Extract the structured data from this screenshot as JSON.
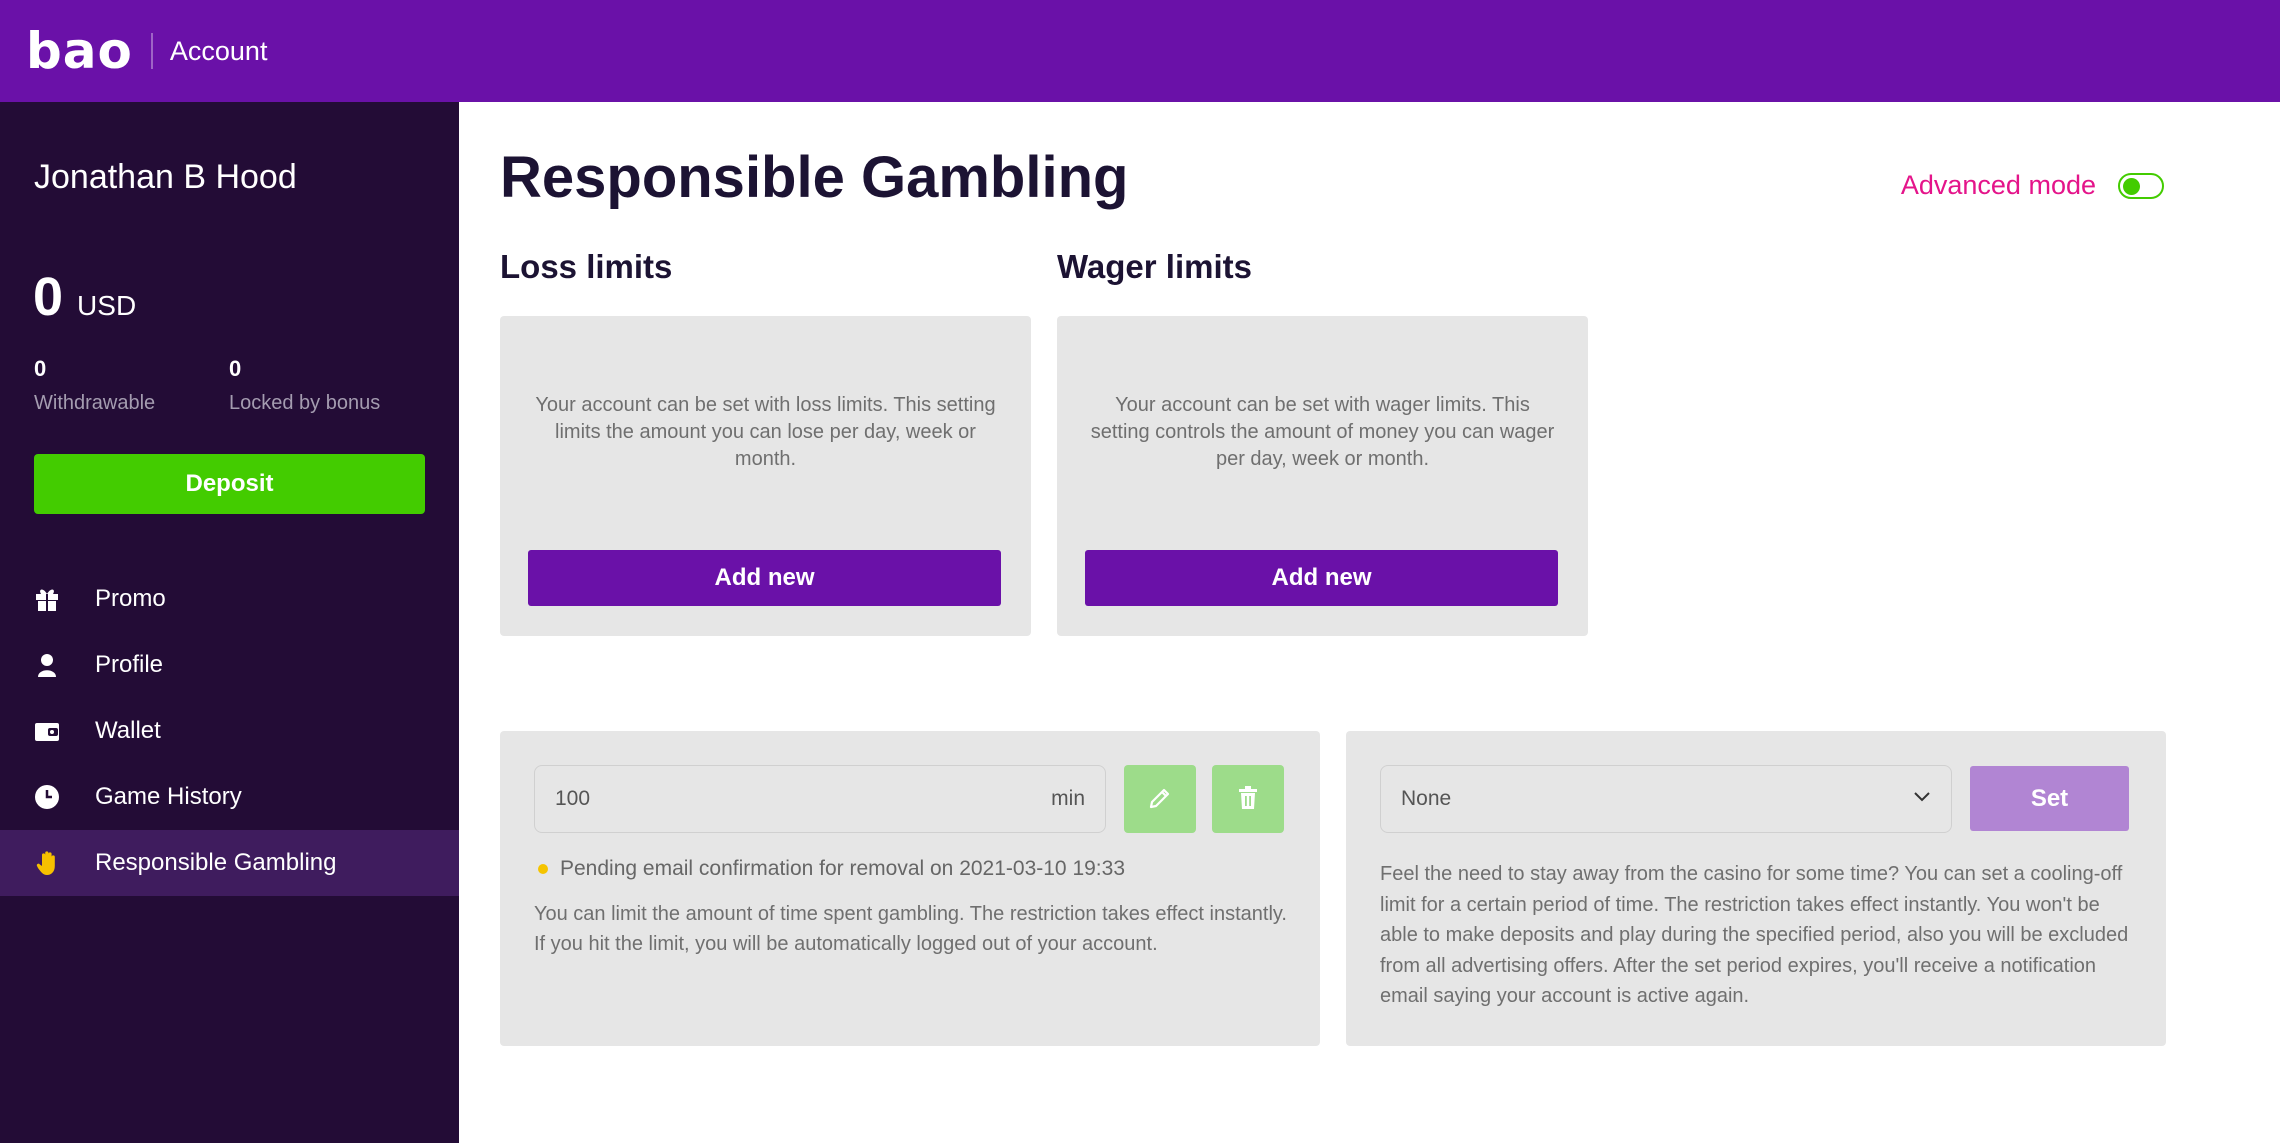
{
  "header": {
    "logo": "bao",
    "title": "Account"
  },
  "sidebar": {
    "user_name": "Jonathan B Hood",
    "balance": {
      "amount": "0",
      "currency": "USD"
    },
    "stats": [
      {
        "value": "0",
        "label": "Withdrawable"
      },
      {
        "value": "0",
        "label": "Locked by bonus"
      }
    ],
    "deposit_label": "Deposit",
    "items": [
      {
        "label": "Promo",
        "icon": "gift-icon"
      },
      {
        "label": "Profile",
        "icon": "user-icon"
      },
      {
        "label": "Wallet",
        "icon": "wallet-icon"
      },
      {
        "label": "Game History",
        "icon": "clock-icon"
      },
      {
        "label": "Responsible Gambling",
        "icon": "hand-icon",
        "active": true
      }
    ]
  },
  "main": {
    "title": "Responsible Gambling",
    "advanced_mode": {
      "label": "Advanced mode",
      "enabled": true
    },
    "loss_limits": {
      "title": "Loss limits",
      "description": "Your account can be set with loss limits. This setting limits the amount you can lose per day, week or month.",
      "button": "Add new"
    },
    "wager_limits": {
      "title": "Wager limits",
      "description": "Your account can be set with wager limits. This setting controls the amount of money you can wager per day, week or month.",
      "button": "Add new"
    },
    "time_limit": {
      "value": "100",
      "unit": "min",
      "pending": "Pending email confirmation for removal on 2021-03-10 19:33",
      "description": "You can limit the amount of time spent gambling. The restriction takes effect instantly. If you hit the limit, you will be automatically logged out of your account."
    },
    "cooling_off": {
      "selected": "None",
      "button": "Set",
      "description": "Feel the need to stay away from the casino for some time? You can set a cooling-off limit for a certain period of time. The restriction takes effect instantly. You won't be able to make deposits and play during the specified period, also you will be excluded from all advertising offers. After the set period expires, you'll receive a notification email saying your account is active again."
    }
  },
  "colors": {
    "header_bg": "#6a11a8",
    "sidebar_bg": "#230c36",
    "sidebar_active": "#3f1c5e",
    "deposit_green": "#43cc00",
    "accent_pink": "#e4148a",
    "button_purple": "#6a11a8",
    "set_disabled": "#b185d3",
    "card_bg": "#e6e6e6",
    "pending_dot": "#f5c400"
  }
}
